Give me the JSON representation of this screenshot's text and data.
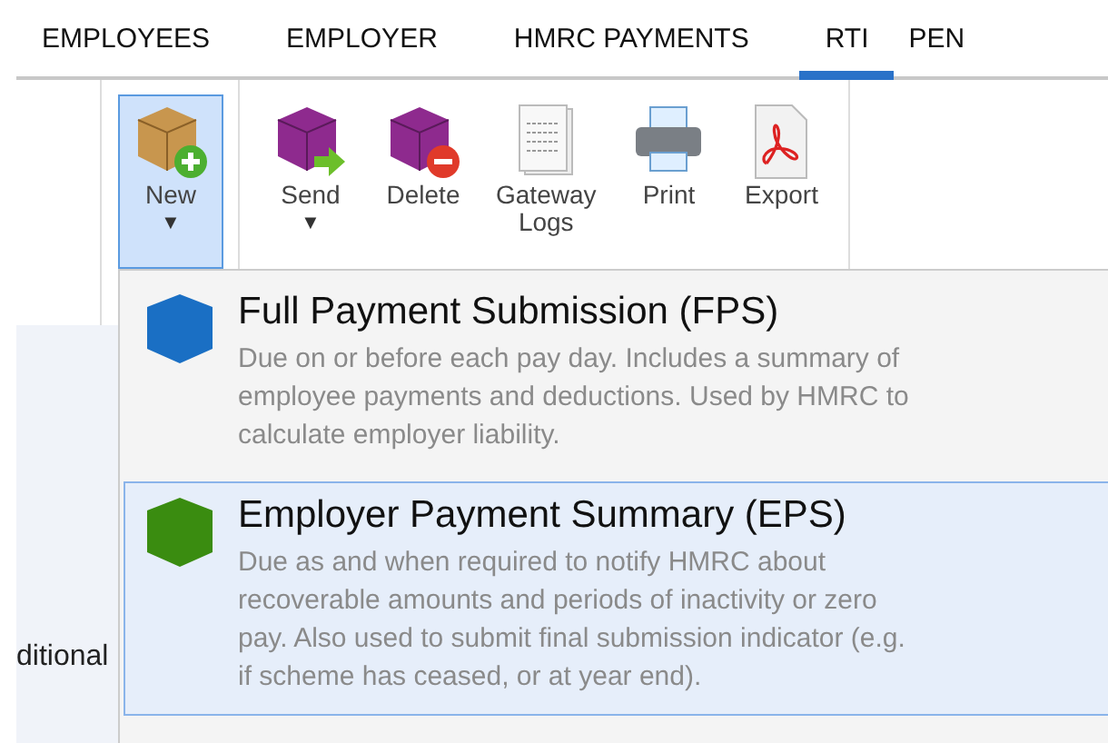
{
  "tabs": [
    {
      "label": "EMPLOYEES",
      "selected": false
    },
    {
      "label": "EMPLOYER",
      "selected": false
    },
    {
      "label": "HMRC PAYMENTS",
      "selected": false
    },
    {
      "label": "RTI",
      "selected": true
    },
    {
      "label": "PEN",
      "selected": false
    }
  ],
  "ribbon": {
    "groups": [
      [
        {
          "kind": "new",
          "label": "New",
          "arrow": "▼",
          "selected": true
        }
      ],
      [
        {
          "kind": "send",
          "label": "Send",
          "arrow": "▼",
          "selected": false
        },
        {
          "kind": "delete",
          "label": "Delete",
          "selected": false
        },
        {
          "kind": "logs",
          "label": "Gateway Logs",
          "selected": false
        },
        {
          "kind": "print",
          "label": "Print",
          "selected": false
        },
        {
          "kind": "export",
          "label": "Export",
          "selected": false
        }
      ]
    ]
  },
  "side_text": "ditional",
  "menu": [
    {
      "title": "Full Payment Submission (FPS)",
      "description": "Due on or before each pay day. Includes a summary of employee payments and deductions. Used by HMRC to calculate employer liability.",
      "color": "#1a6fc4",
      "selected": false
    },
    {
      "title": "Employer Payment Summary (EPS)",
      "description": "Due as and when required to notify HMRC about recoverable amounts and periods of inactivity or zero pay. Also used to submit final submission indicator (e.g. if scheme has ceased, or at year end).",
      "color": "#3a8c10",
      "selected": true
    }
  ]
}
